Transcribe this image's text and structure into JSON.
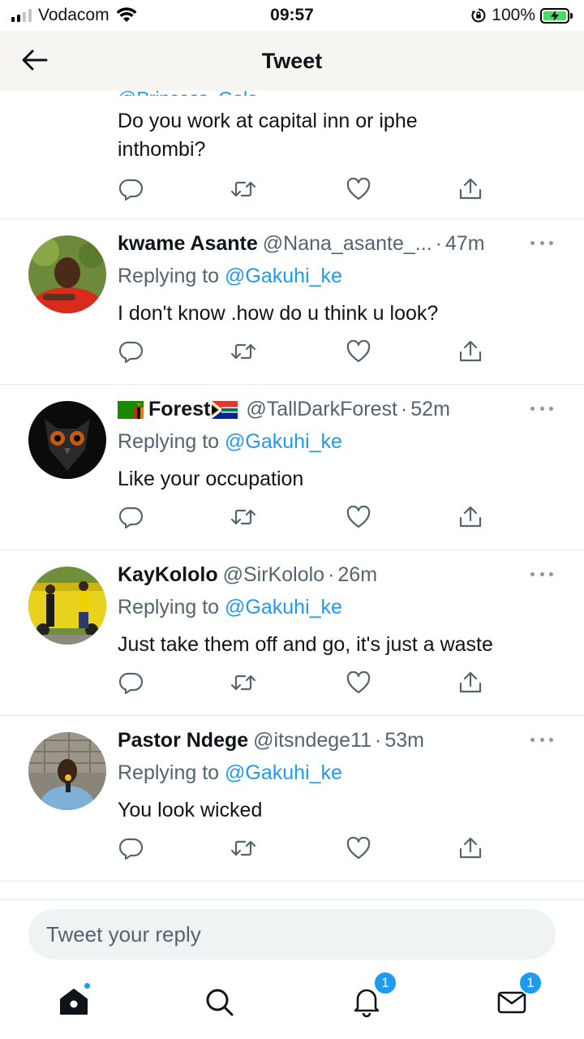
{
  "status_bar": {
    "carrier": "Vodacom",
    "time": "09:57",
    "battery_percent": "100%"
  },
  "header": {
    "title": "Tweet",
    "partial_handle": "@Princess_Gala"
  },
  "top_tweet": {
    "text_line1": "Do you work at capital inn or iphe",
    "text_line2": "inthombi?"
  },
  "replies": [
    {
      "name": "kwame Asante",
      "handle": "@Nana_asante_...",
      "time": "47m",
      "replying_prefix": "Replying to",
      "mention": "@Gakuhi_ke",
      "text": "I don't know .how do u think u look?"
    },
    {
      "name": "Forest",
      "handle": "@TallDarkForest",
      "time": "52m",
      "replying_prefix": "Replying to",
      "mention": "@Gakuhi_ke",
      "text": "Like your occupation"
    },
    {
      "name": "KayKololo",
      "handle": "@SirKololo",
      "time": "26m",
      "replying_prefix": "Replying to",
      "mention": "@Gakuhi_ke",
      "text": "Just take them off and go, it's just a waste"
    },
    {
      "name": "Pastor Ndege",
      "handle": "@itsndege11",
      "time": "53m",
      "replying_prefix": "Replying to",
      "mention": "@Gakuhi_ke",
      "text": "You look wicked"
    }
  ],
  "time_separator": "·",
  "reply_box": {
    "placeholder": "Tweet your reply"
  },
  "tabbar": {
    "notifications_badge": "1",
    "messages_badge": "1"
  },
  "colors": {
    "accent": "#1d9bf0",
    "secondary_text": "#536471",
    "battery_green": "#4cd964"
  },
  "icons": [
    "back-arrow-icon",
    "reply-icon",
    "retweet-icon",
    "like-icon",
    "share-icon",
    "more-icon",
    "home-icon",
    "search-icon",
    "bell-icon",
    "mail-icon"
  ]
}
